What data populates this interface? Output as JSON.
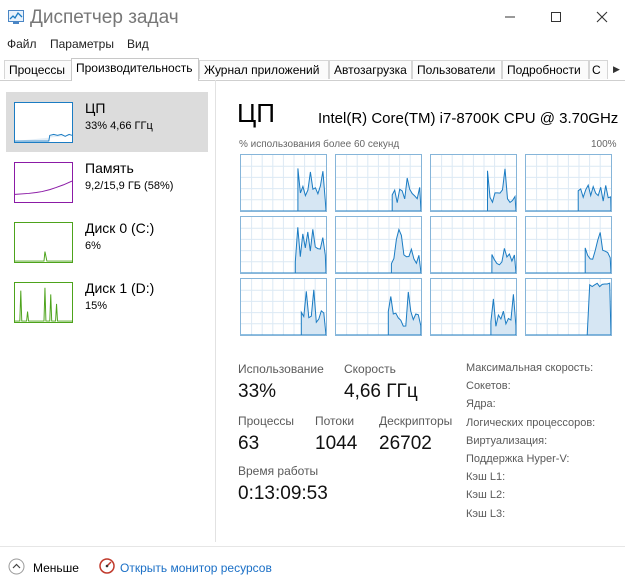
{
  "window": {
    "title": "Диспетчер задач"
  },
  "menu": [
    "Файл",
    "Параметры",
    "Вид"
  ],
  "tabs": [
    "Процессы",
    "Производительность",
    "Журнал приложений",
    "Автозагрузка",
    "Пользователи",
    "Подробности",
    "С"
  ],
  "sidebar": [
    {
      "name": "ЦП",
      "value": "33% 4,66 ГГц",
      "color": "#1b7cc3"
    },
    {
      "name": "Память",
      "value": "9,2/15,9 ГБ (58%)",
      "color": "#8b1aa6"
    },
    {
      "name": "Диск 0 (C:)",
      "value": "6%",
      "color": "#4da31b"
    },
    {
      "name": "Диск 1 (D:)",
      "value": "15%",
      "color": "#4da31b"
    }
  ],
  "cpu": {
    "title": "ЦП",
    "model": "Intel(R) Core(TM) i7-8700K CPU @ 3.70GHz",
    "graph_label_left": "% использования более 60 секунд",
    "graph_label_right": "100%"
  },
  "stats": {
    "usage_label": "Использование",
    "usage_value": "33%",
    "speed_label": "Скорость",
    "speed_value": "4,66 ГГц",
    "processes_label": "Процессы",
    "processes_value": "63",
    "threads_label": "Потоки",
    "threads_value": "1044",
    "handles_label": "Дескрипторы",
    "handles_value": "26702",
    "uptime_label": "Время работы",
    "uptime_value": "0:13:09:53"
  },
  "specs": [
    "Максимальная скорость:",
    "Сокетов:",
    "Ядра:",
    "Логических процессоров:",
    "Виртуализация:",
    "Поддержка Hyper-V:",
    "Кэш L1:",
    "Кэш L2:",
    "Кэш L3:"
  ],
  "footer": {
    "less": "Меньше",
    "monitor": "Открыть монитор ресурсов"
  }
}
